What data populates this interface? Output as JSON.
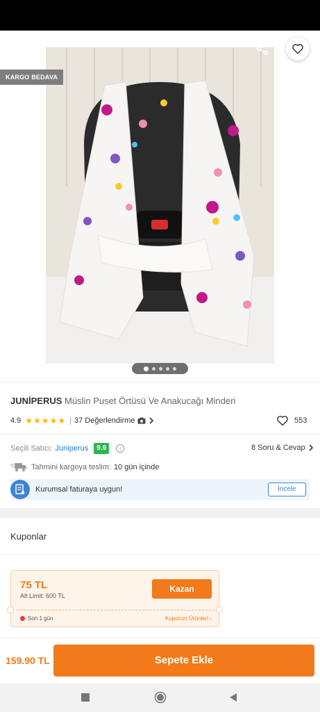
{
  "badges": {
    "kargo": "KARGO BEDAVA"
  },
  "carousel": {
    "count": 5,
    "active_index": 0
  },
  "product": {
    "brand": "JUNİPERUS",
    "name": "Müslin Puset Örtüsü Ve Anakucağı Minderi",
    "rating": "4.9",
    "stars": 5,
    "review_count": "37 Değerlendirme",
    "favorite_count": "553"
  },
  "seller": {
    "label": "Seçili Satıcı:",
    "name": "Juniperus",
    "score": "9.9",
    "qa_link": "8 Soru & Cevap"
  },
  "delivery": {
    "label": "Tahmini kargoya teslim:",
    "value": "10 gün içinde"
  },
  "invoice": {
    "text": "Kurumsal faturaya uygun!",
    "button": "İncele"
  },
  "coupons": {
    "title": "Kuponlar",
    "items": [
      {
        "amount": "75 TL",
        "limit": "Alt Limit: 600 TL",
        "button": "Kazan",
        "timer": "Son 1 gün",
        "products_link": "Kuponun Ürünleri ›"
      }
    ]
  },
  "cart": {
    "price": "159.90 TL",
    "button": "Sepete Ekle"
  },
  "colors": {
    "accent": "#f27a1a",
    "link": "#1b7bd0",
    "score": "#2fb454",
    "star": "#ffb400"
  }
}
